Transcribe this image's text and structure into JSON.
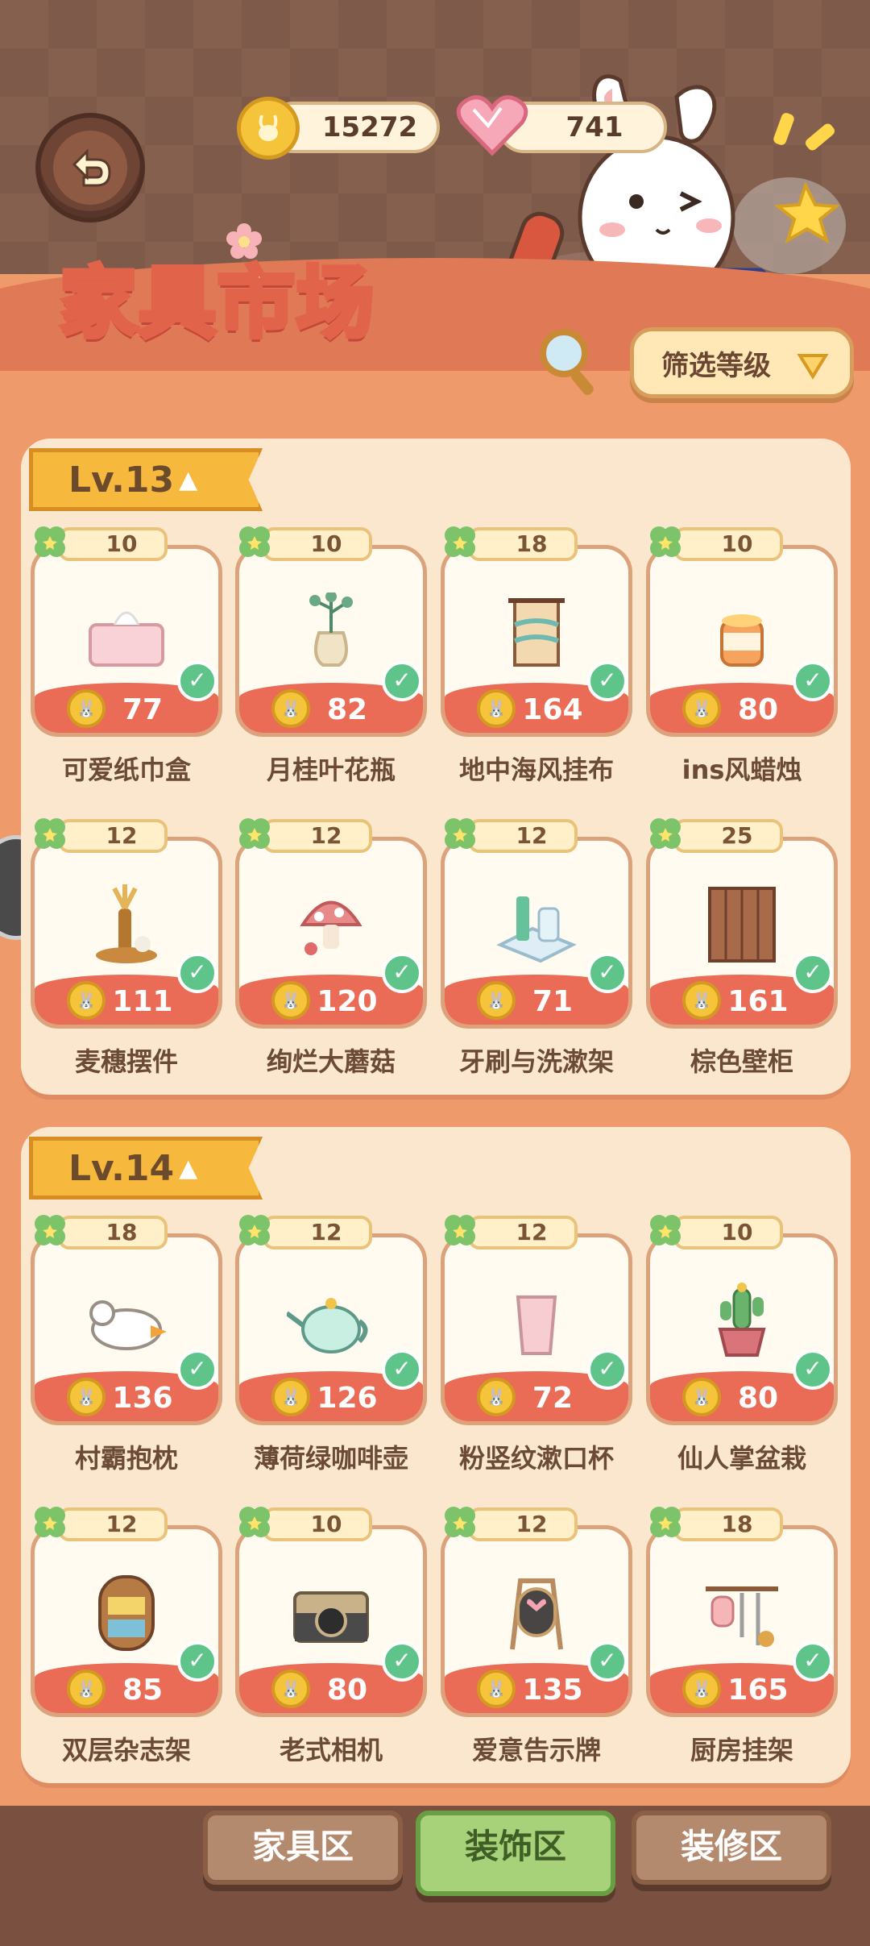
{
  "header": {
    "title": "家具市场",
    "coins": "15272",
    "hearts": "741",
    "filter_label": "筛选等级"
  },
  "sections": [
    {
      "level": "Lv.13",
      "items": [
        {
          "name": "可爱纸巾盒",
          "clover": "10",
          "price": "77",
          "icon": "tissue-box-icon"
        },
        {
          "name": "月桂叶花瓶",
          "clover": "10",
          "price": "82",
          "icon": "vase-icon"
        },
        {
          "name": "地中海风挂布",
          "clover": "18",
          "price": "164",
          "icon": "tapestry-icon"
        },
        {
          "name": "ins风蜡烛",
          "clover": "10",
          "price": "80",
          "icon": "candle-icon"
        },
        {
          "name": "麦穗摆件",
          "clover": "12",
          "price": "111",
          "icon": "wheat-ornament-icon"
        },
        {
          "name": "绚烂大蘑菇",
          "clover": "12",
          "price": "120",
          "icon": "mushroom-icon"
        },
        {
          "name": "牙刷与洗漱架",
          "clover": "12",
          "price": "71",
          "icon": "toothbrush-rack-icon"
        },
        {
          "name": "棕色壁柜",
          "clover": "25",
          "price": "161",
          "icon": "wall-cabinet-icon"
        }
      ]
    },
    {
      "level": "Lv.14",
      "items": [
        {
          "name": "村霸抱枕",
          "clover": "18",
          "price": "136",
          "icon": "goose-pillow-icon"
        },
        {
          "name": "薄荷绿咖啡壶",
          "clover": "12",
          "price": "126",
          "icon": "coffee-pot-icon"
        },
        {
          "name": "粉竖纹漱口杯",
          "clover": "12",
          "price": "72",
          "icon": "cup-icon"
        },
        {
          "name": "仙人掌盆栽",
          "clover": "10",
          "price": "80",
          "icon": "cactus-icon"
        },
        {
          "name": "双层杂志架",
          "clover": "12",
          "price": "85",
          "icon": "magazine-rack-icon"
        },
        {
          "name": "老式相机",
          "clover": "10",
          "price": "80",
          "icon": "camera-icon"
        },
        {
          "name": "爱意告示牌",
          "clover": "12",
          "price": "135",
          "icon": "love-sign-icon"
        },
        {
          "name": "厨房挂架",
          "clover": "18",
          "price": "165",
          "icon": "kitchen-rack-icon"
        }
      ]
    }
  ],
  "tabs": [
    {
      "label": "家具区",
      "active": false
    },
    {
      "label": "装饰区",
      "active": true
    },
    {
      "label": "装修区",
      "active": false
    }
  ],
  "colors": {
    "accent": "#ea6c56",
    "card_bg": "#fffbf1",
    "panel_bg": "#fbe7cd",
    "check": "#5fc48a"
  }
}
